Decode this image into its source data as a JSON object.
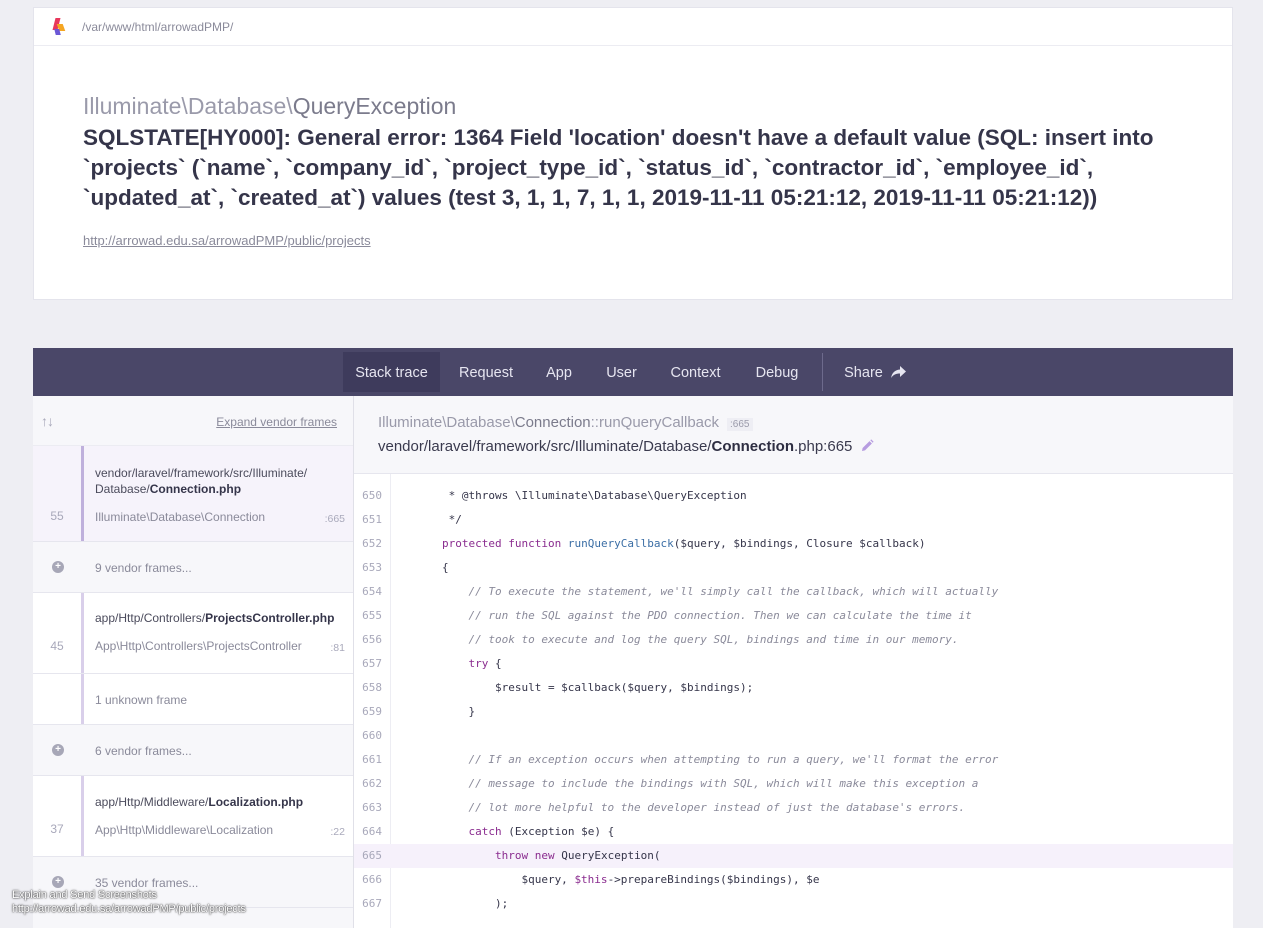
{
  "header": {
    "path": "/var/www/html/arrowadPMP/",
    "exception_namespace": "Illuminate\\Database\\",
    "exception_class": "QueryException",
    "message": "SQLSTATE[HY000]: General error: 1364 Field 'location' doesn't have a default value (SQL: insert into `projects` (`name`, `company_id`, `project_type_id`, `status_id`, `contractor_id`, `employee_id`, `updated_at`, `created_at`) values (test 3, 1, 1, 7, 1, 1, 2019-11-11 05:21:12, 2019-11-11 05:21:12))",
    "url": "http://arrowad.edu.sa/arrowadPMP/public/projects"
  },
  "tabs": {
    "stack_trace": "Stack trace",
    "request": "Request",
    "app": "App",
    "user": "User",
    "context": "Context",
    "debug": "Debug",
    "share": "Share"
  },
  "frames_panel": {
    "arrows": "↑↓",
    "expand_label": "Expand vendor frames",
    "items": [
      {
        "number": "55",
        "file_dir": "vendor/laravel/framework/src/Illuminate/ Database/",
        "file_name": "Connection.php",
        "class": "Illuminate\\Database\\Connection",
        "line": ":665"
      },
      {
        "vendor_text": "9 vendor frames..."
      },
      {
        "number": "45",
        "file_dir": "app/Http/Controllers/",
        "file_name": "ProjectsController.php",
        "class": "App\\Http\\Controllers\\ProjectsController",
        "line": ":81"
      },
      {
        "unknown_text": "1 unknown frame"
      },
      {
        "vendor_text": "6 vendor frames..."
      },
      {
        "number": "37",
        "file_dir": "app/Http/Middleware/",
        "file_name": "Localization.php",
        "class": "App\\Http\\Middleware\\Localization",
        "line": ":22"
      },
      {
        "vendor_text": "35 vendor frames..."
      }
    ]
  },
  "code_header": {
    "class_namespace": "Illuminate\\Database\\",
    "class_name": "Connection",
    "method": "::runQueryCallback",
    "line_badge": ":665",
    "file_dir": "vendor/laravel/framework/src/Illuminate/Database/",
    "file_name": "Connection",
    "file_ext": ".php:665"
  },
  "code": {
    "highlighted_line": "665",
    "lines": [
      {
        "n": "650",
        "code": "         * @throws \\Illuminate\\Database\\QueryException"
      },
      {
        "n": "651",
        "code": "         */"
      },
      {
        "n": "652",
        "code": "        protected function runQueryCallback($query, $bindings, Closure $callback)"
      },
      {
        "n": "653",
        "code": "        {"
      },
      {
        "n": "654",
        "code": "            // To execute the statement, we'll simply call the callback, which will actually"
      },
      {
        "n": "655",
        "code": "            // run the SQL against the PDO connection. Then we can calculate the time it"
      },
      {
        "n": "656",
        "code": "            // took to execute and log the query SQL, bindings and time in our memory."
      },
      {
        "n": "657",
        "code": "            try {"
      },
      {
        "n": "658",
        "code": "                $result = $callback($query, $bindings);"
      },
      {
        "n": "659",
        "code": "            }"
      },
      {
        "n": "660",
        "code": ""
      },
      {
        "n": "661",
        "code": "            // If an exception occurs when attempting to run a query, we'll format the error"
      },
      {
        "n": "662",
        "code": "            // message to include the bindings with SQL, which will make this exception a"
      },
      {
        "n": "663",
        "code": "            // lot more helpful to the developer instead of just the database's errors."
      },
      {
        "n": "664",
        "code": "            catch (Exception $e) {"
      },
      {
        "n": "665",
        "code": "                throw new QueryException("
      },
      {
        "n": "666",
        "code": "                    $query, $this->prepareBindings($bindings), $e"
      },
      {
        "n": "667",
        "code": "                );"
      }
    ]
  },
  "watermark": {
    "line1": "Explain and Send Screenshots",
    "line2": "http://arrowad.edu.sa/arrowadPMP/public/projects"
  }
}
